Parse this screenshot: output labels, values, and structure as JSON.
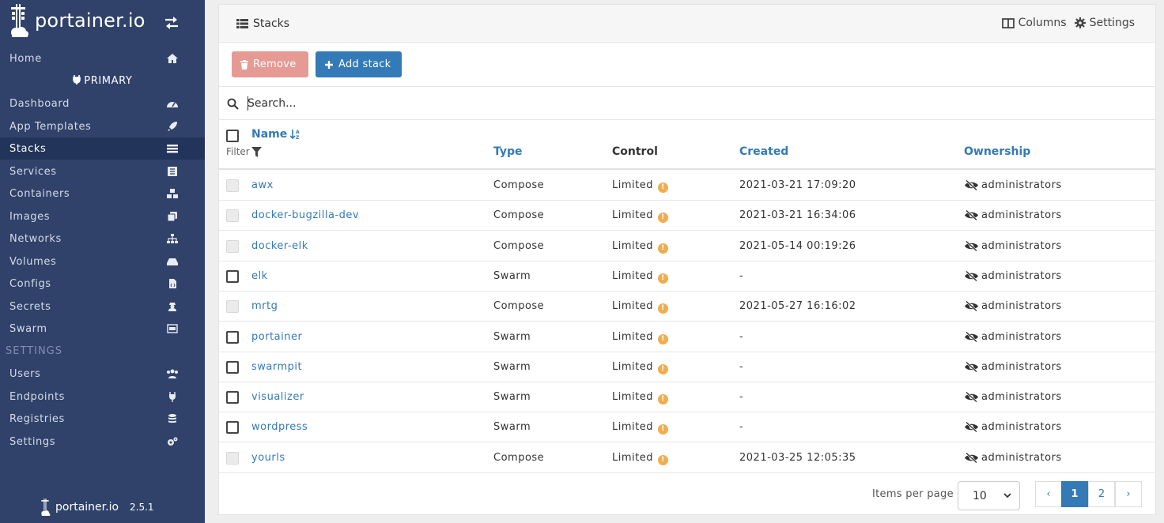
{
  "app": {
    "brand": "portainer.io",
    "version": "2.5.1"
  },
  "sidebar": {
    "home": "Home",
    "endpoint_section": "PRIMARY",
    "items": [
      {
        "label": "Dashboard",
        "icon": "tachometer-icon"
      },
      {
        "label": "App Templates",
        "icon": "rocket-icon"
      },
      {
        "label": "Stacks",
        "icon": "list-icon"
      },
      {
        "label": "Services",
        "icon": "list-alt-icon"
      },
      {
        "label": "Containers",
        "icon": "cubes-icon"
      },
      {
        "label": "Images",
        "icon": "clone-icon"
      },
      {
        "label": "Networks",
        "icon": "sitemap-icon"
      },
      {
        "label": "Volumes",
        "icon": "hdd-icon"
      },
      {
        "label": "Configs",
        "icon": "file-code-icon"
      },
      {
        "label": "Secrets",
        "icon": "user-secret-icon"
      },
      {
        "label": "Swarm",
        "icon": "object-group-icon"
      }
    ],
    "settings_heading": "SETTINGS",
    "settings_items": [
      {
        "label": "Users",
        "icon": "users-icon"
      },
      {
        "label": "Endpoints",
        "icon": "plug-icon"
      },
      {
        "label": "Registries",
        "icon": "database-icon"
      },
      {
        "label": "Settings",
        "icon": "cogs-icon"
      }
    ],
    "active": "Stacks"
  },
  "panel": {
    "title": "Stacks",
    "columns_label": "Columns",
    "settings_label": "Settings",
    "remove_label": "Remove",
    "add_label": "Add stack",
    "search_placeholder": "Search...",
    "filter_label": "Filter"
  },
  "table": {
    "headers": {
      "name": "Name",
      "type": "Type",
      "control": "Control",
      "created": "Created",
      "ownership": "Ownership"
    },
    "rows": [
      {
        "name": "awx",
        "type": "Compose",
        "control": "Limited",
        "created": "2021-03-21 17:09:20",
        "ownership": "administrators",
        "selectable": false
      },
      {
        "name": "docker-bugzilla-dev",
        "type": "Compose",
        "control": "Limited",
        "created": "2021-03-21 16:34:06",
        "ownership": "administrators",
        "selectable": false
      },
      {
        "name": "docker-elk",
        "type": "Compose",
        "control": "Limited",
        "created": "2021-05-14 00:19:26",
        "ownership": "administrators",
        "selectable": false
      },
      {
        "name": "elk",
        "type": "Swarm",
        "control": "Limited",
        "created": "-",
        "ownership": "administrators",
        "selectable": true
      },
      {
        "name": "mrtg",
        "type": "Compose",
        "control": "Limited",
        "created": "2021-05-27 16:16:02",
        "ownership": "administrators",
        "selectable": false
      },
      {
        "name": "portainer",
        "type": "Swarm",
        "control": "Limited",
        "created": "-",
        "ownership": "administrators",
        "selectable": true
      },
      {
        "name": "swarmpit",
        "type": "Swarm",
        "control": "Limited",
        "created": "-",
        "ownership": "administrators",
        "selectable": true
      },
      {
        "name": "visualizer",
        "type": "Swarm",
        "control": "Limited",
        "created": "-",
        "ownership": "administrators",
        "selectable": true
      },
      {
        "name": "wordpress",
        "type": "Swarm",
        "control": "Limited",
        "created": "-",
        "ownership": "administrators",
        "selectable": true
      },
      {
        "name": "yourls",
        "type": "Compose",
        "control": "Limited",
        "created": "2021-03-25 12:05:35",
        "ownership": "administrators",
        "selectable": false
      }
    ]
  },
  "pagination": {
    "items_per_page_label": "Items per page",
    "items_per_page": "10",
    "prev": "‹",
    "next": "›",
    "pages": [
      "1",
      "2"
    ],
    "current": "1"
  },
  "colors": {
    "sidebar": "#30426a",
    "accent": "#337ab7",
    "warning": "#f0ad4e",
    "danger_light": "#e69a94"
  }
}
